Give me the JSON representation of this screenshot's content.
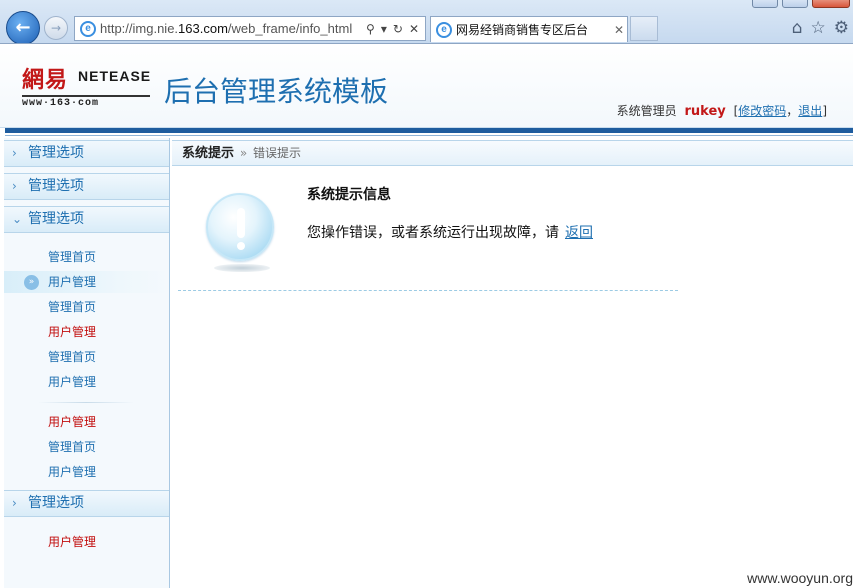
{
  "browser": {
    "url_prefix": "http://img.nie.",
    "url_domain": "163.com",
    "url_suffix": "/web_frame/info_html",
    "tab_title": "网易经销商销售专区后台",
    "ie_logo": "e",
    "icons": [
      "back-arrow-icon",
      "forward-arrow-icon",
      "search-icon",
      "dropdown-icon",
      "refresh-icon",
      "stop-icon",
      "tab-close-icon",
      "home-icon",
      "favorites-star-icon",
      "settings-gear-icon"
    ]
  },
  "header": {
    "logo_cn": "網易",
    "logo_en": "NETEASE",
    "logo_url": "www·163·com",
    "system_title": "后台管理系统模板",
    "role_label": "系统管理员",
    "username": "rukey",
    "change_password": "修改密码",
    "logout": "退出",
    "bracket_open": "[",
    "comma": "，",
    "bracket_close": "]"
  },
  "sidebar": {
    "sections": [
      {
        "label": "管理选项",
        "expanded": false
      },
      {
        "label": "管理选项",
        "expanded": false
      },
      {
        "label": "管理选项",
        "expanded": true
      },
      {
        "label": "管理选项",
        "expanded": true
      }
    ],
    "items": [
      {
        "label": "管理首页",
        "color": "blue"
      },
      {
        "label": "用户管理",
        "color": "blue",
        "active": true
      },
      {
        "label": "管理首页",
        "color": "blue"
      },
      {
        "label": "用户管理",
        "color": "red"
      },
      {
        "label": "管理首页",
        "color": "blue"
      },
      {
        "label": "用户管理",
        "color": "blue"
      },
      {
        "label": "用户管理",
        "color": "red"
      },
      {
        "label": "管理首页",
        "color": "blue"
      },
      {
        "label": "用户管理",
        "color": "blue"
      },
      {
        "label": "用户管理",
        "color": "red"
      }
    ]
  },
  "breadcrumb": {
    "current": "系统提示",
    "separator": "»",
    "sub": "错误提示"
  },
  "message": {
    "title": "系统提示信息",
    "body": "您操作错误，或者系统运行出现故障，请",
    "link": "返回",
    "icon": "info-exclamation-icon"
  },
  "watermark": "www.wooyun.org",
  "colors": {
    "accent_blue": "#1e6fb0",
    "header_band": "#1e5c9e",
    "alert_red": "#c20e0e"
  }
}
